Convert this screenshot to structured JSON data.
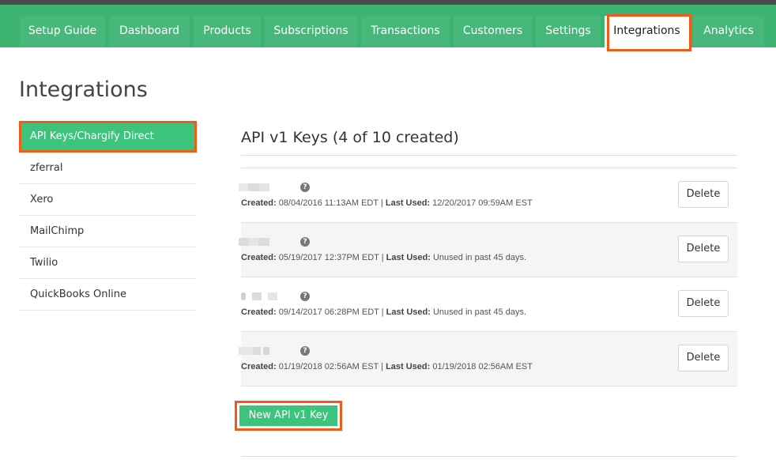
{
  "nav": {
    "tabs": [
      {
        "label": "Setup Guide",
        "active": false
      },
      {
        "label": "Dashboard",
        "active": false
      },
      {
        "label": "Products",
        "active": false
      },
      {
        "label": "Subscriptions",
        "active": false
      },
      {
        "label": "Transactions",
        "active": false
      },
      {
        "label": "Customers",
        "active": false
      },
      {
        "label": "Settings",
        "active": false
      },
      {
        "label": "Integrations",
        "active": true
      },
      {
        "label": "Analytics",
        "active": false
      }
    ]
  },
  "page": {
    "title": "Integrations"
  },
  "sidebar": {
    "items": [
      {
        "label": "API Keys/Chargify Direct",
        "active": true
      },
      {
        "label": "zferral",
        "active": false
      },
      {
        "label": "Xero",
        "active": false
      },
      {
        "label": "MailChimp",
        "active": false
      },
      {
        "label": "Twilio",
        "active": false
      },
      {
        "label": "QuickBooks Online",
        "active": false
      }
    ]
  },
  "keys_section": {
    "title": "API v1 Keys (4 of 10 created)",
    "created_label": "Created:",
    "last_used_label": "Last Used:",
    "separator": " | ",
    "delete_label": "Delete",
    "help_icon_glyph": "?",
    "keys": [
      {
        "created": "08/04/2016 11:13AM EDT",
        "last_used": "12/20/2017 09:59AM EST"
      },
      {
        "created": "05/19/2017 12:37PM EDT",
        "last_used": "Unused in past 45 days."
      },
      {
        "created": "09/14/2017 06:28PM EDT",
        "last_used": "Unused in past 45 days."
      },
      {
        "created": "01/19/2018 02:56AM EST",
        "last_used": "01/19/2018 02:56AM EST"
      }
    ],
    "new_key_label": "New API v1 Key"
  },
  "colors": {
    "nav_green": "#3cb371",
    "active_green": "#3cc47c",
    "highlight_orange": "#f05a1a"
  }
}
